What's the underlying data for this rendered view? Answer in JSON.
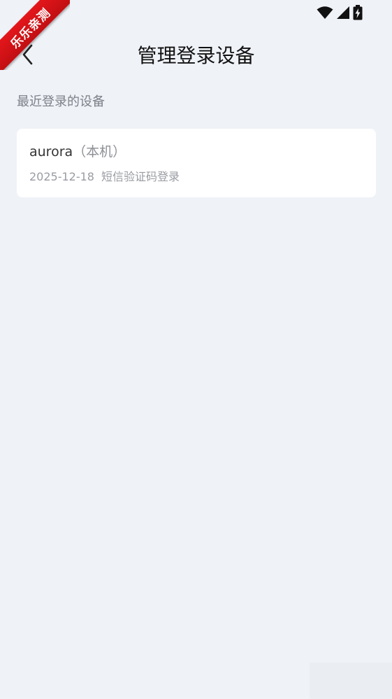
{
  "ribbon": {
    "text": "乐乐亲测"
  },
  "status_bar": {
    "icons": [
      "wifi-icon",
      "signal-icon",
      "battery-charging-icon"
    ]
  },
  "header": {
    "back_icon": "chevron-left-icon",
    "title": "管理登录设备"
  },
  "section": {
    "label": "最近登录的设备"
  },
  "devices": [
    {
      "name": "aurora",
      "tag": "（本机）",
      "date": "2025-12-18",
      "method": "短信验证码登录"
    }
  ],
  "colors": {
    "background": "#eff2f7",
    "card": "#ffffff",
    "title": "#111111",
    "muted": "#9a9ca3",
    "ribbon": "#d9131a"
  }
}
